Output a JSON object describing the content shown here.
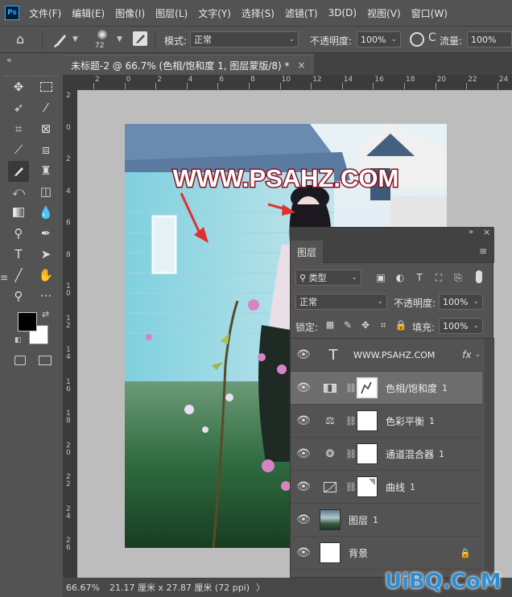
{
  "menu": [
    "文件(F)",
    "编辑(E)",
    "图像(I)",
    "图层(L)",
    "文字(Y)",
    "选择(S)",
    "滤镜(T)",
    "3D(D)",
    "视图(V)",
    "窗口(W)"
  ],
  "app_icon": "Ps",
  "options": {
    "brush_size": "72",
    "mode_label": "模式:",
    "mode_value": "正常",
    "opacity_label": "不透明度:",
    "opacity_value": "100%",
    "flow_label": "流量:",
    "flow_value": "100%"
  },
  "tab": {
    "title": "未标题-2 @ 66.7% (色相/饱和度 1, 图层蒙版/8) *",
    "close": "×"
  },
  "collapse": "«",
  "ruler_h": [
    "2",
    "0",
    "2",
    "4",
    "6",
    "8",
    "10",
    "12",
    "14",
    "16",
    "18",
    "20",
    "22",
    "24"
  ],
  "ruler_v": [
    "2",
    "0",
    "2",
    "4",
    "6",
    "8",
    "1\n0",
    "1\n2",
    "1\n4",
    "1\n6",
    "1\n8",
    "2\n0",
    "2\n2",
    "2\n4",
    "2\n6"
  ],
  "watermark": "WWW.PSAHZ.COM",
  "status": {
    "zoom": "66.67%",
    "size": "21.17 厘米 x 27.87 厘米 (72 ppi)",
    "arrow": "〉"
  },
  "layers_panel": {
    "title": "图层",
    "filter_label": "类型",
    "blend_mode": "正常",
    "opacity_label": "不透明度:",
    "opacity_value": "100%",
    "lock_label": "锁定:",
    "fill_label": "填充:",
    "fill_value": "100%",
    "layers": [
      {
        "name": "WWW.PSAHZ.COM",
        "kind": "text",
        "fx": "fx",
        "selected": false
      },
      {
        "name": "色相/饱和度",
        "num": "1",
        "kind": "hue-sat",
        "selected": true
      },
      {
        "name": "色彩平衡",
        "num": "1",
        "kind": "color-balance",
        "selected": false
      },
      {
        "name": "通道混合器",
        "num": "1",
        "kind": "channel-mixer",
        "selected": false
      },
      {
        "name": "曲线",
        "num": "1",
        "kind": "curves",
        "selected": false
      },
      {
        "name": "图层",
        "num": "1",
        "kind": "pixel",
        "selected": false
      },
      {
        "name": "背景",
        "kind": "background",
        "selected": false
      }
    ]
  },
  "site_watermark": "UiBQ.CoM",
  "colors": {
    "accent": "#31a8ff",
    "watermark_red": "#c8102e",
    "panel": "#535353",
    "selected_row": "#6e6e6e"
  }
}
